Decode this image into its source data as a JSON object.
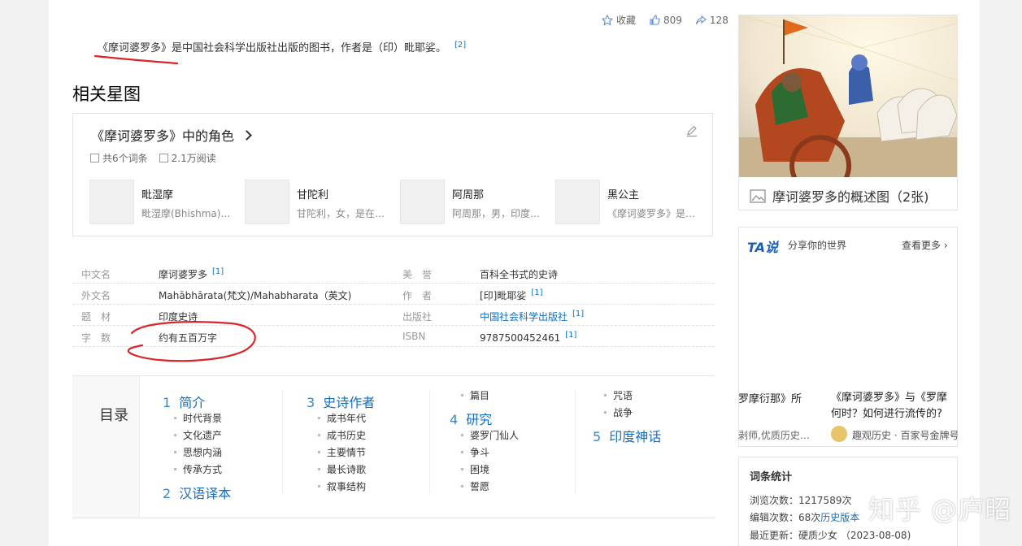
{
  "actions": {
    "collect": "收藏",
    "like_count": "809",
    "share_count": "128"
  },
  "intro": {
    "title": "《摩诃婆罗多》",
    "text": "是中国社会科学出版社出版的图书，作者是（印）毗耶娑。",
    "ref": "[2]"
  },
  "section_title": "相关星图",
  "starmap": {
    "title": "《摩诃婆罗多》中的角色",
    "entries": "共6个词条",
    "reads": "2.1万阅读",
    "roles": [
      {
        "name": "毗湿摩",
        "desc": "毗湿摩(Bhishma)…"
      },
      {
        "name": "甘陀利",
        "desc": "甘陀利，女，是在…"
      },
      {
        "name": "阿周那",
        "desc": "阿周那，男，印度…"
      },
      {
        "name": "黑公主",
        "desc": "《摩诃婆罗多》是…"
      }
    ]
  },
  "info": [
    {
      "k1": "中文名",
      "v1": "摩诃婆罗多",
      "r1": "[1]",
      "k2": "美　誉",
      "v2": "百科全书式的史诗",
      "r2": ""
    },
    {
      "k1": "外文名",
      "v1": "Mahābhārata(梵文)/Mahabharata（英文)",
      "r1": "",
      "k2": "作　者",
      "v2": "[印]毗耶娑",
      "r2": "[1]"
    },
    {
      "k1": "题　材",
      "v1": "印度史诗",
      "r1": "",
      "k2": "出版社",
      "v2": "中国社会科学出版社",
      "r2": "[1]"
    },
    {
      "k1": "字　数",
      "v1": "约有五百万字",
      "r1": "",
      "k2": "ISBN",
      "v2": "9787500452461",
      "r2": "[1]"
    }
  ],
  "catalog": {
    "label": "目录",
    "s1": {
      "num": "1",
      "title": "简介",
      "items": [
        "时代背景",
        "文化遗产",
        "思想内涵",
        "传承方式"
      ]
    },
    "s2": {
      "num": "2",
      "title": "汉语译本"
    },
    "s3": {
      "num": "3",
      "title": "史诗作者",
      "items": [
        "成书年代",
        "成书历史",
        "主要情节",
        "最长诗歌",
        "叙事结构"
      ]
    },
    "s3_extra": "篇目",
    "s4": {
      "num": "4",
      "title": "研究",
      "items": [
        "婆罗门仙人",
        "争斗",
        "困境",
        "誓愿"
      ]
    },
    "s4_extra": [
      "咒语",
      "战争"
    ],
    "s5": {
      "num": "5",
      "title": "印度神话"
    }
  },
  "album": {
    "caption": "摩诃婆罗多的概述图（2张)"
  },
  "ta": {
    "logo": "TA说",
    "slogan": "分享你的世界",
    "more": "查看更多",
    "card1_title": "罗摩衍那》所",
    "card1_sub": "剥师,优质历史…",
    "card2_title": "《摩诃婆罗多》与《罗摩",
    "card2_title2": "何时？如何进行流传的?",
    "card2_sub": "趣观历史 · 百家号金牌号"
  },
  "stats": {
    "title": "词条统计",
    "views_label": "浏览次数：",
    "views": "1217589次",
    "edits_label": "编辑次数：",
    "edits": "68次",
    "history": "历史版本",
    "updated_label": "最近更新：",
    "updated": "硬质少女 （2023-08-08)"
  },
  "watermark": "知乎 @庐昭"
}
